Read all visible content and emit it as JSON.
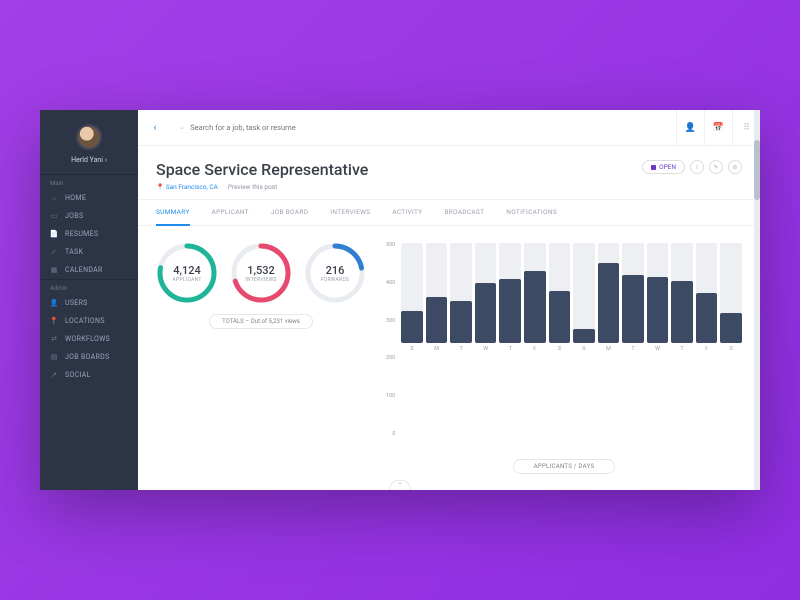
{
  "user": {
    "name": "Herld Yani"
  },
  "sidebar": {
    "section1_label": "Main",
    "section2_label": "Admin",
    "main_items": [
      {
        "label": "HOME",
        "icon": "home-icon"
      },
      {
        "label": "JOBS",
        "icon": "briefcase-icon"
      },
      {
        "label": "RESUMES",
        "icon": "file-icon"
      },
      {
        "label": "TASK",
        "icon": "check-icon"
      },
      {
        "label": "CALENDAR",
        "icon": "calendar-icon"
      }
    ],
    "admin_items": [
      {
        "label": "USERS",
        "icon": "user-icon"
      },
      {
        "label": "LOCATIONS",
        "icon": "pin-icon"
      },
      {
        "label": "WORKFLOWS",
        "icon": "flow-icon"
      },
      {
        "label": "JOB BOARDS",
        "icon": "board-icon"
      },
      {
        "label": "SOCIAL",
        "icon": "share-icon"
      }
    ]
  },
  "search": {
    "placeholder": "Search for a job, task or resume"
  },
  "page": {
    "title": "Space Service Representative",
    "location": "San Francisco, CA",
    "preview": "Preview this post",
    "status": "OPEN"
  },
  "tabs": [
    "SUMMARY",
    "APPLICANT",
    "JOB BOARD",
    "INTERVIEWS",
    "ACTIVITY",
    "BROADCAST",
    "NOTIFICATIONS"
  ],
  "stats": {
    "applicant": {
      "value": "4,124",
      "label": "APPLICANT",
      "color": "#1fb598",
      "pct": 0.78
    },
    "interviews": {
      "value": "1,532",
      "label": "INTERVIEWS",
      "color": "#e84a6f",
      "pct": 0.7
    },
    "forwards": {
      "value": "216",
      "label": "FORWARDS",
      "color": "#2f7fd1",
      "pct": 0.22
    },
    "totals_caption": "TOTALS – Out of 5,231 views"
  },
  "chart_data": {
    "type": "bar",
    "title": "APPLICANTS / DAYS",
    "ylabel": "",
    "xlabel": "",
    "ylim": [
      0,
      500
    ],
    "yticks": [
      500,
      400,
      300,
      200,
      100,
      0
    ],
    "categories": [
      "S",
      "M",
      "T",
      "W",
      "T",
      "F",
      "S",
      "S",
      "M",
      "T",
      "W",
      "T",
      "F",
      "S"
    ],
    "values": [
      160,
      230,
      210,
      300,
      320,
      360,
      260,
      70,
      400,
      340,
      330,
      310,
      250,
      150
    ]
  }
}
